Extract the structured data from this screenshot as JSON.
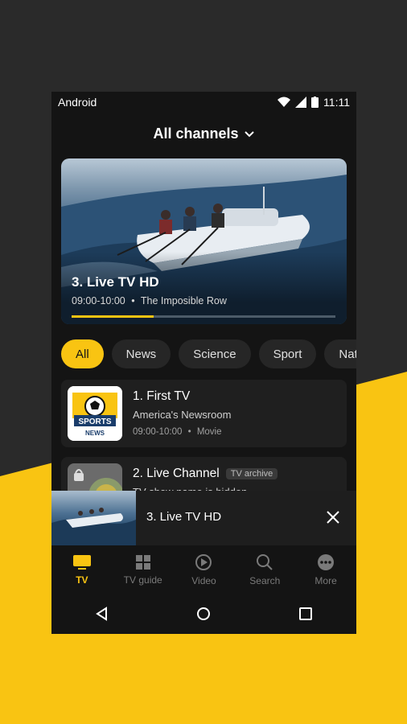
{
  "status_bar": {
    "carrier": "Android",
    "time": "11:11"
  },
  "header": {
    "title": "All channels"
  },
  "hero": {
    "channel": "3. Live TV HD",
    "time": "09:00-10:00",
    "separator": "•",
    "program": "The Imposible Row",
    "progress": 0.31
  },
  "filters": [
    "All",
    "News",
    "Science",
    "Sport",
    "Natu"
  ],
  "channels": [
    {
      "title": "1. First TV",
      "subtitle": "America's Newsroom",
      "time": "09:00-10:00",
      "separator": "•",
      "genre": "Movie",
      "logo_text_1": "SPORTS",
      "logo_text_2": "NEWS"
    },
    {
      "title": "2. Live Channel",
      "badge": "TV archive",
      "subtitle": "TV show name is hidden"
    }
  ],
  "mini_player": {
    "title": "3. Live TV HD"
  },
  "bottom_nav": {
    "items": [
      {
        "label": "TV",
        "icon": "tv-icon"
      },
      {
        "label": "TV guide",
        "icon": "grid-icon"
      },
      {
        "label": "Video",
        "icon": "play-circle-icon"
      },
      {
        "label": "Search",
        "icon": "search-icon"
      },
      {
        "label": "More",
        "icon": "more-icon"
      }
    ]
  },
  "colors": {
    "accent": "#f9c412",
    "background": "#141414",
    "card": "#1f1f1f"
  }
}
